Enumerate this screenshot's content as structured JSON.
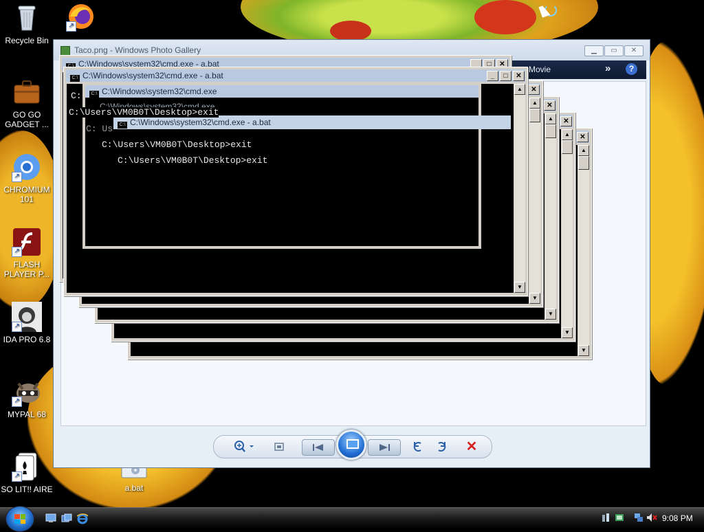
{
  "desktop": {
    "icons": [
      {
        "label": "Recycle Bin",
        "icon": "recycle-bin-icon"
      },
      {
        "label": "GO GO GADGET ...",
        "icon": "briefcase-icon"
      },
      {
        "label": "CHROMIUM 101",
        "icon": "chromium-icon"
      },
      {
        "label": "FLASH PLAYER P...",
        "icon": "flash-icon"
      },
      {
        "label": "IDA PRO 6.8",
        "icon": "ida-icon"
      },
      {
        "label": "MYPAL 68",
        "icon": "raccoon-icon"
      },
      {
        "label": "SO LIT!! AIRE",
        "icon": "cards-icon"
      },
      {
        "label": "a.bat",
        "icon": "batch-file-icon"
      },
      {
        "label": "",
        "icon": "firefox-icon"
      }
    ]
  },
  "photo_gallery": {
    "title": "Taco.png - Windows Photo Gallery",
    "toolbar": {
      "movie_label": "Movie",
      "more": "»",
      "help": "?"
    },
    "controls": [
      "zoom",
      "fit",
      "previous",
      "slideshow",
      "next",
      "rotate-left",
      "rotate-right",
      "delete"
    ]
  },
  "cmd": {
    "title_bat": "C:\\Windows\\system32\\cmd.exe - a.bat",
    "title": "C:\\Windows\\system32\\cmd.exe",
    "line_exit": "C:\\Users\\VM0B0T\\Desktop>exit",
    "fragment_c": "C:",
    "fragment_cs": "C: Us"
  },
  "taskbar": {
    "clock": "9:08 PM"
  },
  "colors": {
    "cmd_bg": "#000000",
    "cmd_text": "#c0c0c0",
    "gallery_bg": "#e6eef6",
    "taskbar": "#1b1b1b"
  }
}
